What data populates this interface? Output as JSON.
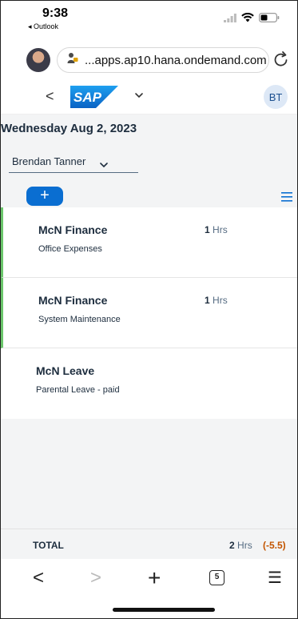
{
  "status_bar": {
    "time": "9:38",
    "back_app": "◂ Outlook"
  },
  "browser": {
    "url": "...apps.ap10.hana.ondemand.com"
  },
  "shell": {
    "back_glyph": "<",
    "logo_text": "SAP",
    "avatar_initials": "BT"
  },
  "header": {
    "date": "Wednesday Aug 2, 2023",
    "user_select": "Brendan Tanner",
    "add_label": "+"
  },
  "entries": [
    {
      "title": "McN Finance",
      "subtitle": "Office Expenses",
      "hours": "1",
      "unit": "Hrs",
      "marked": true
    },
    {
      "title": "McN Finance",
      "subtitle": "System Maintenance",
      "hours": "1",
      "unit": "Hrs",
      "marked": true
    },
    {
      "title": "McN Leave",
      "subtitle": "Parental Leave - paid",
      "hours": "",
      "unit": "",
      "marked": false
    }
  ],
  "total": {
    "label": "TOTAL",
    "hours": "2",
    "unit": "Hrs",
    "difference": "(-5.5)"
  },
  "toolbar": {
    "back": "<",
    "forward": ">",
    "new_tab": "+",
    "tab_count": "5",
    "menu": "☰"
  },
  "colors": {
    "accent": "#0a6ed1",
    "marker": "#6bc66b",
    "deficit": "#c35500",
    "sap_blue": "#1a7fd6"
  }
}
